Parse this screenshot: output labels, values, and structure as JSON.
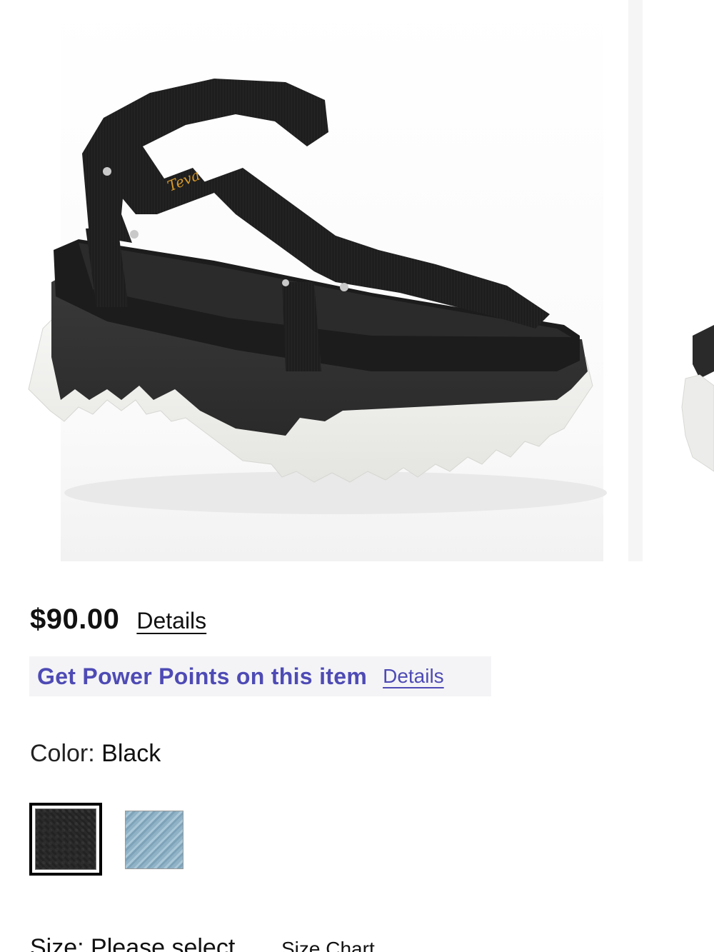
{
  "product": {
    "price": "$90.00",
    "price_details_link": "Details",
    "points_banner": {
      "text": "Get Power Points on this item",
      "details_link": "Details"
    },
    "color": {
      "label": "Color:",
      "selected": "Black",
      "swatches": [
        {
          "name": "Black",
          "selected": true,
          "color": "#262626"
        },
        {
          "name": "Light Blue",
          "selected": false,
          "color": "#9fbccd"
        }
      ]
    },
    "size": {
      "label": "Size:",
      "value": "Please select",
      "chart_link": "Size Chart"
    },
    "image": {
      "brand_mark": "Teva"
    }
  },
  "colors": {
    "points_accent": "#4e4bb5",
    "points_background": "#f4f4f6"
  }
}
